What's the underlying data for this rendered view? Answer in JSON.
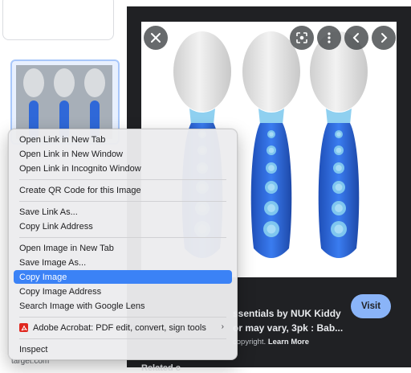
{
  "left": {
    "source_label": "target.com"
  },
  "preview": {
    "title_line1": "ssentials by NUK Kiddy",
    "title_line2": "or may vary, 3pk : Bab...",
    "visit_label": "Visit",
    "copyright_text": "copyright.",
    "learn_more": "Learn More",
    "related_partial": "Related c",
    "icons": [
      "close-icon",
      "lens-icon",
      "more-vert-icon",
      "chevron-left-icon",
      "chevron-right-icon"
    ]
  },
  "context_menu": {
    "items": [
      "Open Link in New Tab",
      "Open Link in New Window",
      "Open Link in Incognito Window",
      "Create QR Code for this Image",
      "Save Link As...",
      "Copy Link Address",
      "Open Image in New Tab",
      "Save Image As...",
      "Copy Image",
      "Copy Image Address",
      "Search Image with Google Lens",
      "Adobe Acrobat: PDF edit, convert, sign tools",
      "Inspect"
    ],
    "highlighted": "Copy Image",
    "submenu_arrow": "›"
  },
  "colors": {
    "preview_bg": "#202124",
    "visit_button": "#8ab4f8",
    "menu_highlight": "#3b82f6",
    "spoon_handle": "#2f6fe0",
    "spoon_bowl": "#e6e6e6"
  }
}
